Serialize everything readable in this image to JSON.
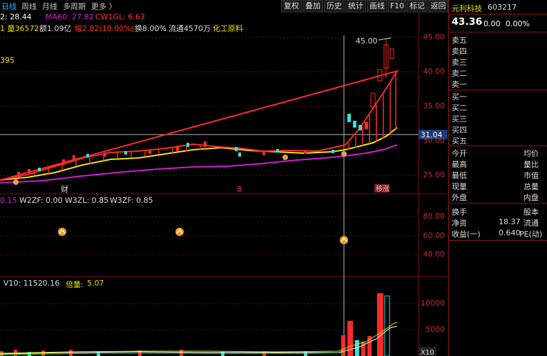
{
  "toolbar": {
    "tabs": [
      "日线",
      "周线",
      "月线",
      "多周期",
      "更多 〉"
    ],
    "buttons": [
      "复权",
      "叠加",
      "历史",
      "统计",
      "画线",
      "F10",
      "标记",
      "返回"
    ]
  },
  "main_info": {
    "ma2": "2: 28.44",
    "ma60": "MA60: 27.82",
    "cw": "CW1GL: 6.63",
    "vol_prefix": "1 量36572",
    "amount": "额1.09亿",
    "change": "幅2.82(10.00%)",
    "turnover": "换8.00%",
    "float": "流通4570万",
    "industry": "化工原料",
    "left_value": "395",
    "max_label": "45.00",
    "marker_cai_1": "财",
    "marker_8": "8",
    "marker_limit": "移涨",
    "price_tag": "31.04"
  },
  "indicator_info": {
    "w1": "0.15",
    "w2": "W2ZF: 0.00",
    "w3zl": "W3ZL: 0.85",
    "w3zf": "W3ZF: 0.85"
  },
  "volume_info": {
    "v10": "V10: 11520.16",
    "ratio_label": "倍量:",
    "ratio_value": "5.07",
    "unit": "X10"
  },
  "axes": {
    "price_ticks": [
      "45.00",
      "40.00",
      "35.00",
      "30.00",
      "25.00"
    ],
    "indicator_ticks": [
      "80.00",
      "60.00",
      "40.00"
    ],
    "volume_ticks": [
      "10000",
      "5000"
    ]
  },
  "stock": {
    "name": "元利科技",
    "code": "603217",
    "price": "43.36",
    "change": "0.00",
    "pct": "0.00%"
  },
  "orderbook": {
    "asks": [
      "卖五",
      "卖四",
      "卖三",
      "卖二",
      "卖一"
    ],
    "bids": [
      "买一",
      "买二",
      "买三",
      "买四",
      "买五"
    ]
  },
  "stats": {
    "left": [
      "今开",
      "最高",
      "最低",
      "现量",
      "外盘"
    ],
    "right": [
      "均价",
      "量比",
      "市值",
      "总量",
      "内盘"
    ]
  },
  "finance": [
    {
      "label": "换手",
      "value": "",
      "tail": "股本"
    },
    {
      "label": "净资",
      "value": "18.37",
      "tail": "流通"
    },
    {
      "label": "收益(一)",
      "value": "0.640",
      "tail": "PE(动)"
    }
  ],
  "colors": {
    "up": "#ff2a2a",
    "down": "#35e0e0",
    "ma_yellow": "#f5e60c",
    "ma_purple": "#d21bd8",
    "accent_blue": "#23b8ff"
  }
}
